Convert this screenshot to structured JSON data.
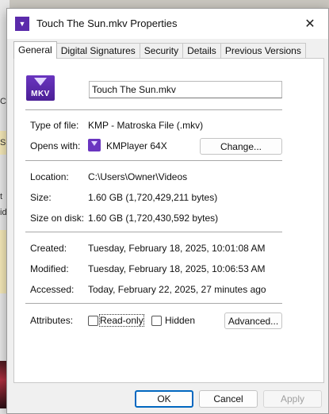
{
  "background": {
    "letters": [
      "C",
      "S",
      "t",
      "id"
    ]
  },
  "window": {
    "title": "Touch The Sun.mkv Properties",
    "icon": "mkv-file-icon",
    "close_glyph": "✕"
  },
  "tabs": [
    {
      "label": "General",
      "active": true
    },
    {
      "label": "Digital Signatures",
      "active": false
    },
    {
      "label": "Security",
      "active": false
    },
    {
      "label": "Details",
      "active": false
    },
    {
      "label": "Previous Versions",
      "active": false
    }
  ],
  "general": {
    "file_icon_label": "MKV",
    "file_name": "Touch The Sun.mkv",
    "type_label": "Type of file:",
    "type_value": "KMP - Matroska File (.mkv)",
    "opens_label": "Opens with:",
    "opens_value": "KMPlayer 64X",
    "change_button": "Change...",
    "location_label": "Location:",
    "location_value": "C:\\Users\\Owner\\Videos",
    "size_label": "Size:",
    "size_value": "1.60 GB (1,720,429,211 bytes)",
    "size_disk_label": "Size on disk:",
    "size_disk_value": "1.60 GB (1,720,430,592 bytes)",
    "created_label": "Created:",
    "created_value": "Tuesday, February 18, 2025, 10:01:08 AM",
    "modified_label": "Modified:",
    "modified_value": "Tuesday, February 18, 2025, 10:06:53 AM",
    "accessed_label": "Accessed:",
    "accessed_value": "Today, February 22, 2025, 27 minutes ago",
    "attributes_label": "Attributes:",
    "readonly_label": "Read-only",
    "readonly_checked": false,
    "hidden_label": "Hidden",
    "hidden_checked": false,
    "advanced_button": "Advanced..."
  },
  "footer": {
    "ok": "OK",
    "cancel": "Cancel",
    "apply": "Apply"
  },
  "colors": {
    "accent": "#0067c0",
    "app_icon": "#6a35c0"
  }
}
